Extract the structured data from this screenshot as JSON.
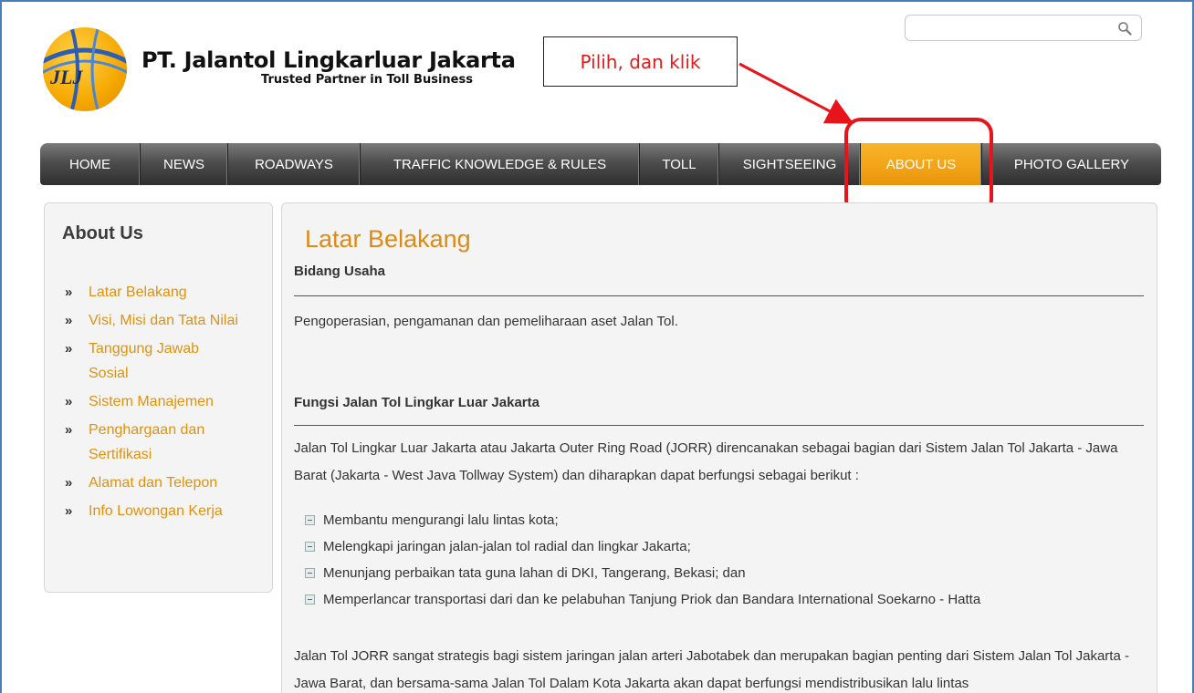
{
  "header": {
    "logo_text": "JLJ",
    "company_name": "PT. Jalantol Lingkarluar Jakarta",
    "tagline": "Trusted Partner in Toll Business"
  },
  "search": {
    "value": "",
    "placeholder": "",
    "icon": "magnifier-icon"
  },
  "annotation": {
    "callout_text": "Pilih, dan klik",
    "color": "#e8141c"
  },
  "nav": {
    "items": [
      {
        "label": "HOME"
      },
      {
        "label": "NEWS"
      },
      {
        "label": "ROADWAYS"
      },
      {
        "label": "TRAFFIC KNOWLEDGE & RULES"
      },
      {
        "label": "TOLL"
      },
      {
        "label": "SIGHTSEEING"
      },
      {
        "label": "ABOUT US",
        "active": true
      },
      {
        "label": "PHOTO GALLERY"
      }
    ],
    "active_color": "#f3a418"
  },
  "sidebar": {
    "title": "About Us",
    "items": [
      {
        "label": "Latar Belakang"
      },
      {
        "label": "Visi, Misi dan Tata Nilai"
      },
      {
        "label": "Tanggung Jawab Sosial"
      },
      {
        "label": "Sistem Manajemen"
      },
      {
        "label": "Penghargaan dan Sertifikasi"
      },
      {
        "label": "Alamat dan Telepon"
      },
      {
        "label": "Info Lowongan Kerja"
      }
    ],
    "link_color": "#e0920e"
  },
  "content": {
    "title": "Latar Belakang",
    "section1_title": "Bidang Usaha",
    "section1_text": "Pengoperasian, pengamanan dan pemeliharaan aset Jalan Tol.",
    "section2_title": "Fungsi Jalan Tol Lingkar Luar Jakarta",
    "section2_intro": "Jalan Tol Lingkar Luar Jakarta atau Jakarta Outer Ring Road (JORR) direncanakan sebagai bagian dari Sistem Jalan Tol Jakarta - Jawa Barat (Jakarta - West Java Tollway System) dan diharapkan dapat berfungsi sebagai berikut :",
    "bullets": [
      "Membantu mengurangi lalu lintas kota;",
      "Melengkapi jaringan jalan-jalan tol radial dan lingkar Jakarta;",
      "Menunjang perbaikan tata guna lahan di DKI, Tangerang, Bekasi; dan",
      "Memperlancar transportasi dari dan ke pelabuhan Tanjung Priok dan Bandara International Soekarno - Hatta"
    ],
    "closing_text": "Jalan Tol JORR sangat strategis bagi sistem jaringan jalan arteri Jabotabek dan merupakan bagian penting dari Sistem Jalan Tol Jakarta - Jawa Barat, dan bersama-sama Jalan Tol Dalam Kota Jakarta akan dapat berfungsi mendistribusikan lalu lintas"
  }
}
